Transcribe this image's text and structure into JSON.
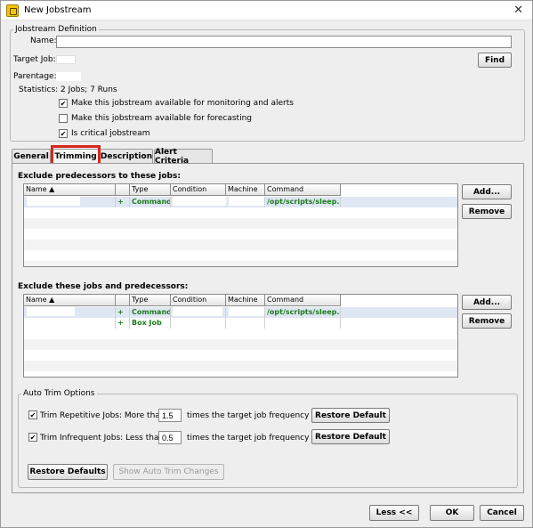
{
  "window": {
    "title": "New Jobstream",
    "close": "✕"
  },
  "definition": {
    "legend": "Jobstream Definition",
    "name_label": "Name:",
    "name_value": "",
    "target_job_label": "Target Job:",
    "parentage_label": "Parentage:",
    "statistics": "Statistics: 2 Jobs; 7 Runs",
    "find_button": "Find",
    "options": [
      {
        "label": "Make this jobstream available for monitoring and alerts",
        "checked": true
      },
      {
        "label": "Make this jobstream available for forecasting",
        "checked": false
      },
      {
        "label": "Is critical jobstream",
        "checked": true
      }
    ]
  },
  "tabs": [
    {
      "label": "General",
      "active": false
    },
    {
      "label": "Trimming",
      "active": true
    },
    {
      "label": "Description",
      "active": false
    },
    {
      "label": "Alert Criteria",
      "active": false
    }
  ],
  "predecessors": {
    "title": "Exclude predecessors to these jobs:",
    "columns": [
      "Name ▲",
      "",
      "Type",
      "Condition",
      "Machine",
      "Command"
    ],
    "rows": [
      {
        "expander": "+",
        "type": "Command",
        "command": "/opt/scripts/sleep.pl"
      }
    ],
    "add_button": "Add...",
    "remove_button": "Remove"
  },
  "jobs": {
    "title": "Exclude these jobs and predecessors:",
    "columns": [
      "Name ▲",
      "",
      "Type",
      "Condition",
      "Machine",
      "Command"
    ],
    "rows": [
      {
        "expander": "+",
        "type": "Command",
        "command": "/opt/scripts/sleep.pl"
      },
      {
        "expander": "+",
        "type": "Box Job",
        "command": ""
      }
    ],
    "add_button": "Add...",
    "remove_button": "Remove"
  },
  "auto_trim": {
    "legend": "Auto Trim Options",
    "repetitive_label": "Trim Repetitive Jobs: More than",
    "repetitive_value": "1.5",
    "repetitive_suffix": "times the target job frequency",
    "repetitive_checked": true,
    "infrequent_label": "Trim Infrequent Jobs: Less than",
    "infrequent_value": "0.5",
    "infrequent_suffix": "times the target job frequency",
    "infrequent_checked": true,
    "restore_default": "Restore Default",
    "restore_defaults": "Restore Defaults",
    "show_changes": "Show Auto Trim Changes"
  },
  "footer": {
    "less": "Less <<",
    "ok": "OK",
    "cancel": "Cancel"
  },
  "highlight_color": "#d9261c",
  "command_color": "#1c7a1c"
}
